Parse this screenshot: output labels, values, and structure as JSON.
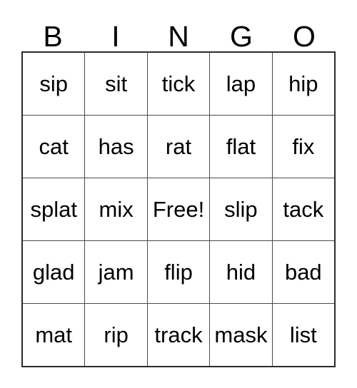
{
  "card": {
    "title": "BINGO",
    "header_letters": [
      "B",
      "I",
      "N",
      "G",
      "O"
    ],
    "free_space_label": "Free!",
    "free_space_position": {
      "row": 2,
      "col": 2
    },
    "grid_size": "5x5",
    "colors": {
      "background": "#ffffff",
      "text": "#000000",
      "outer_border": "#2b2b2b",
      "inner_border": "#4a4a4a"
    },
    "columns": {
      "B": [
        "sip",
        "cat",
        "splat",
        "glad",
        "mat"
      ],
      "I": [
        "sit",
        "has",
        "mix",
        "jam",
        "rip"
      ],
      "N": [
        "tick",
        "rat",
        "Free!",
        "flip",
        "track"
      ],
      "G": [
        "lap",
        "flat",
        "slip",
        "hid",
        "mask"
      ],
      "O": [
        "hip",
        "fix",
        "tack",
        "bad",
        "list"
      ]
    },
    "rows": [
      [
        "sip",
        "sit",
        "tick",
        "lap",
        "hip"
      ],
      [
        "cat",
        "has",
        "rat",
        "flat",
        "fix"
      ],
      [
        "splat",
        "mix",
        "Free!",
        "slip",
        "tack"
      ],
      [
        "glad",
        "jam",
        "flip",
        "hid",
        "bad"
      ],
      [
        "mat",
        "rip",
        "track",
        "mask",
        "list"
      ]
    ]
  }
}
